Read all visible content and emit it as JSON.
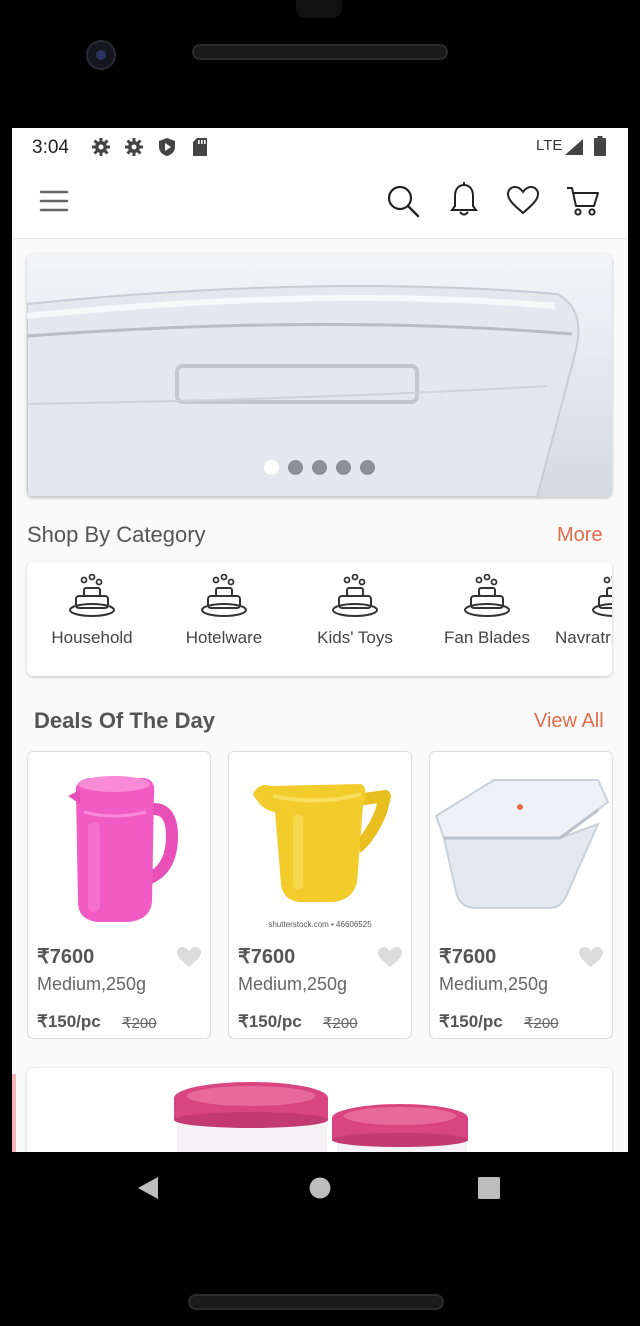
{
  "status_bar": {
    "time": "3:04",
    "network": "LTE",
    "icons": [
      "settings-icon",
      "settings-icon",
      "shield-icon",
      "sd-card-icon",
      "signal-icon",
      "battery-icon"
    ]
  },
  "app_bar": {
    "icons": [
      "menu-icon",
      "search-icon",
      "bell-icon",
      "heart-icon",
      "cart-icon"
    ],
    "accent_color": "#e06c4b"
  },
  "banner": {
    "slides": 5,
    "active_slide": 0
  },
  "categories": {
    "title": "Shop By Category",
    "more_label": "More",
    "items": [
      {
        "label": "Household"
      },
      {
        "label": "Hotelware"
      },
      {
        "label": "Kids' Toys"
      },
      {
        "label": "Fan Blades"
      },
      {
        "label": "Navratri"
      }
    ]
  },
  "deals": {
    "title": "Deals Of The Day",
    "view_all_label": "View All",
    "items": [
      {
        "price": "₹7600",
        "qty": "Medium,250g",
        "per": "₹150/pc",
        "old": "₹200",
        "color": "#f05bc4"
      },
      {
        "price": "₹7600",
        "qty": "Medium,250g",
        "per": "₹150/pc",
        "old": "₹200",
        "color": "#f2cc2a",
        "watermark": "shutterstock.com • 46606525"
      },
      {
        "price": "₹7600",
        "qty": "Medium,250g",
        "per": "₹150/pc",
        "old": "₹200",
        "color": "#dfe7ef"
      }
    ]
  }
}
